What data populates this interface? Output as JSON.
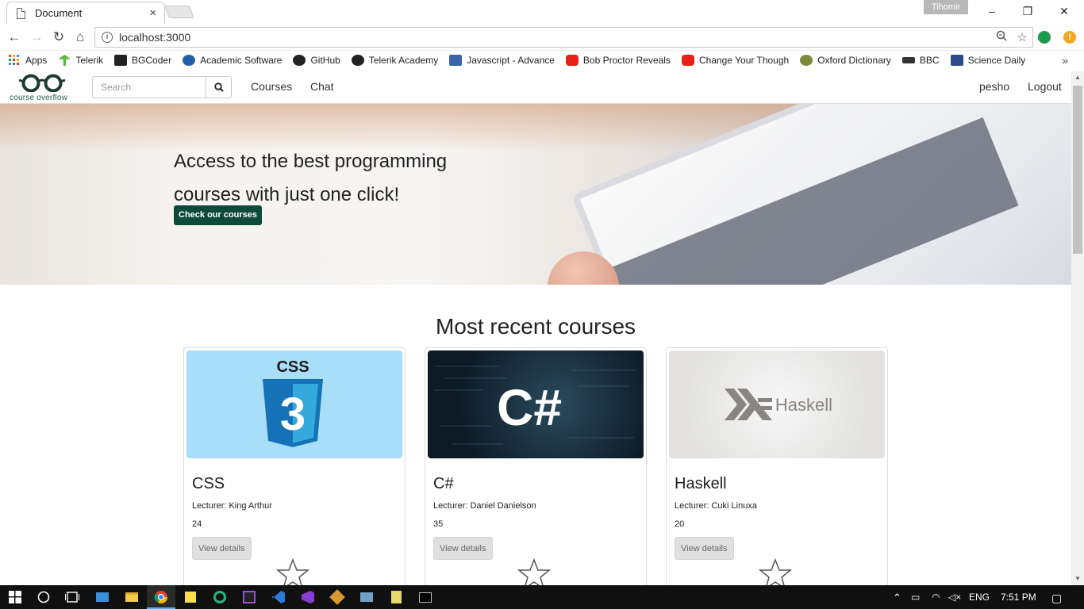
{
  "browser": {
    "tab_title": "Document",
    "tab_close": "×",
    "profile_name": "Tihomir",
    "url": "localhost:3000",
    "window_controls": {
      "minimize": "–",
      "maximize": "❐",
      "close": "✕"
    },
    "nav": {
      "back": "←",
      "forward": "→",
      "reload": "↻",
      "home": "⌂"
    },
    "extension_badge": "!",
    "bookmarks": [
      {
        "label": "Apps",
        "icon": "apps-grid-icon",
        "color": "#e23b2e"
      },
      {
        "label": "Telerik",
        "icon": "telerik-icon",
        "color": "#5ab83c"
      },
      {
        "label": "BGCoder",
        "icon": "bgcoder-icon",
        "color": "#222222"
      },
      {
        "label": "Academic Software",
        "icon": "academic-software-icon",
        "color": "#2060a8"
      },
      {
        "label": "GitHub",
        "icon": "github-icon",
        "color": "#222222"
      },
      {
        "label": "Telerik Academy",
        "icon": "github-icon",
        "color": "#222222"
      },
      {
        "label": "Javascript - Advance",
        "icon": "ci-icon",
        "color": "#3b63a8"
      },
      {
        "label": "Bob Proctor Reveals",
        "icon": "youtube-icon",
        "color": "#e62117"
      },
      {
        "label": "Change Your Though",
        "icon": "youtube-icon",
        "color": "#e62117"
      },
      {
        "label": "Oxford Dictionary",
        "icon": "oxford-icon",
        "color": "#7a8a3a"
      },
      {
        "label": "BBC",
        "icon": "bbc-icon",
        "color": "#333333"
      },
      {
        "label": "Science Daily",
        "icon": "sciencedaily-icon",
        "color": "#2c4b8a"
      }
    ],
    "bookmarks_more": "»"
  },
  "site": {
    "logo_text": "course overflow",
    "search_placeholder": "Search",
    "nav_links": [
      "Courses",
      "Chat"
    ],
    "user": "pesho",
    "logout": "Logout",
    "hero": {
      "headline": "Access to the best programming courses with just one click!",
      "cta": "Check our courses"
    },
    "section_title": "Most recent courses",
    "courses": [
      {
        "name": "CSS",
        "lecturer": "Lecturer: King Arthur",
        "count": "24",
        "details": "View details",
        "thumb_text": "CSS",
        "thumb_number": "3"
      },
      {
        "name": "C#",
        "lecturer": "Lecturer: Daniel Danielson",
        "count": "35",
        "details": "View details",
        "thumb_text": "C#"
      },
      {
        "name": "Haskell",
        "lecturer": "Lecturer: Cuki Linuxa",
        "count": "20",
        "details": "View details",
        "thumb_text": "Haskell"
      }
    ],
    "accent_color": "#0d4a3a"
  },
  "taskbar": {
    "language": "ENG",
    "time": "7:51 PM"
  }
}
